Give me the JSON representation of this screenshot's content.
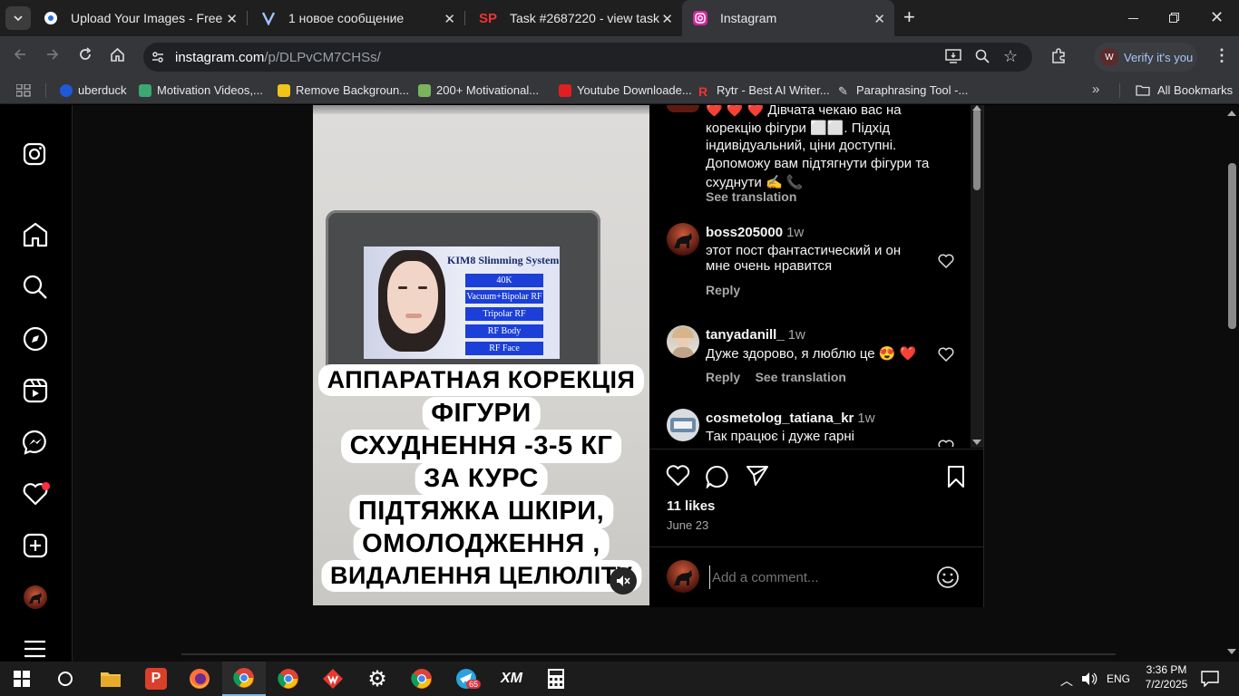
{
  "browser": {
    "tabs": [
      {
        "title": "Upload Your Images - Free Ima"
      },
      {
        "title": "1 новое сообщение"
      },
      {
        "title": "Task #2687220 - view task"
      },
      {
        "title": "Instagram"
      }
    ],
    "url_host": "instagram.com",
    "url_path": "/p/DLPvCM7CHSs/",
    "profile_label": "Verify it's you",
    "bookmarks": [
      "uberduck",
      "Motivation Videos,...",
      "Remove Backgroun...",
      "200+ Motivational...",
      "Youtube Downloade...",
      "Rytr - Best AI Writer...",
      "Paraphrasing Tool -..."
    ],
    "all_bookmarks": "All Bookmarks"
  },
  "media": {
    "screen_title": "KIM8 Slimming System",
    "screen_buttons": [
      "40K",
      "Vacuum+Bipolar RF",
      "Tripolar RF",
      "RF Body",
      "RF Face"
    ],
    "overlay_lines": [
      "АППАРАТНАЯ КОРЕКЦІЯ",
      "ФІГУРИ",
      "СХУДНЕННЯ -3-5 КГ",
      "ЗА КУРС",
      "ПІДТЯЖКА ШКІРИ,",
      "ОМОЛОДЖЕННЯ ,",
      "ВИДАЛЕННЯ ЦЕЛЮЛІТУ"
    ]
  },
  "caption": {
    "lines": [
      "❤️ ❤️ ❤️ Дівчата чекаю вас на",
      "корекцію фігури ⬜⬜. Підхід",
      "індивідуальний, ціни доступні.",
      "Допоможу вам підтягнути фігури та",
      "схуднути ✍️ 📞"
    ],
    "see_translation": "See translation"
  },
  "comments": [
    {
      "user": "boss205000",
      "time": "1w",
      "text": [
        "этот пост фантастический и он",
        "мне очень нравится"
      ],
      "reply": "Reply"
    },
    {
      "user": "tanyadanill_",
      "time": "1w",
      "text": [
        "Дуже здорово, я люблю це 😍 ❤️"
      ],
      "reply": "Reply",
      "see_translation": "See translation"
    },
    {
      "user": "cosmetolog_tatiana_kr",
      "time": "1w",
      "text": [
        "Так працює і дуже гарні"
      ]
    }
  ],
  "actions": {
    "likes": "11 likes",
    "date": "June 23",
    "comment_placeholder": "Add a comment..."
  },
  "taskbar": {
    "lang": "ENG",
    "time": "3:36 PM",
    "date": "7/2/2025",
    "telegram_badge": "65"
  },
  "colors": {
    "instagram_bg": "#000000",
    "notification_dot": "#ff3040",
    "link_gray": "#a8a8a8",
    "screen_button_blue": "#1c3fd8"
  }
}
